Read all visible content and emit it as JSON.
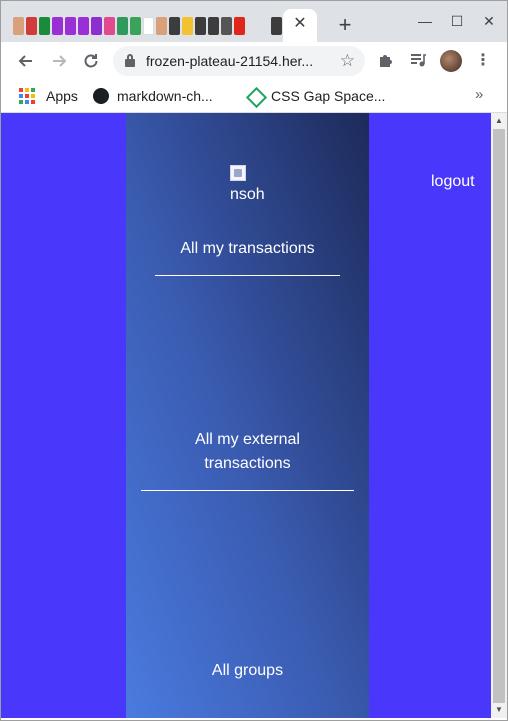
{
  "browser": {
    "tab_close": "✕",
    "new_tab": "+",
    "window_controls": {
      "minimize": "—",
      "maximize": "☐",
      "close": "✕"
    },
    "url": "frozen-plateau-21154.her...",
    "bookmarks": [
      {
        "label": "Apps",
        "icon": "apps-grid-icon"
      },
      {
        "label": "markdown-ch...",
        "icon": "github-icon"
      },
      {
        "label": "CSS Gap Space...",
        "icon": "css-diamond-icon"
      }
    ],
    "bookmarks_more": "»"
  },
  "page": {
    "logout": "logout",
    "logo_alt": "nsoh",
    "menu": [
      {
        "label": "All my transactions"
      },
      {
        "label": "All my external transactions"
      },
      {
        "label": "All groups"
      }
    ]
  },
  "colors": {
    "page_bg": "#4a37fc",
    "panel_gradient_top": "#1d2a5a",
    "panel_gradient_bottom": "#4a7be0",
    "text": "#ffffff"
  }
}
